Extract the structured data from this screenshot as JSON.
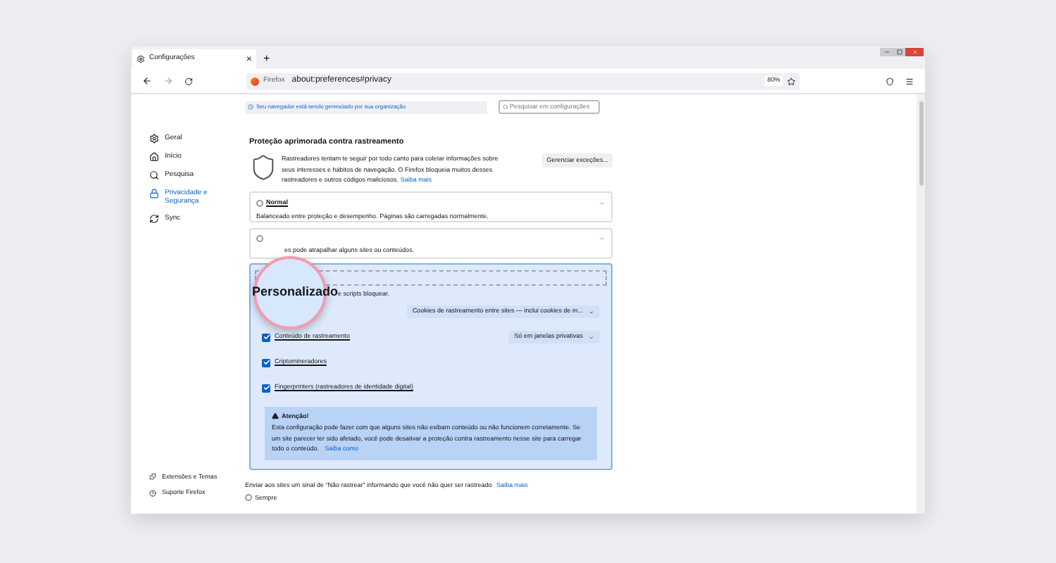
{
  "tab": {
    "title": "Configurações",
    "close": "×",
    "new_tab": "+"
  },
  "nav": {
    "site_label": "Firefox",
    "url": "about:preferences#privacy",
    "zoom": "80%"
  },
  "notice": "Seu navegador está sendo gerenciado por sua organização",
  "search": {
    "placeholder": "Pesquisar em configurações"
  },
  "sidebar": {
    "items": [
      {
        "label": "Geral",
        "selected": false
      },
      {
        "label": "Início",
        "selected": false
      },
      {
        "label": "Pesquisa",
        "selected": false
      },
      {
        "label": "Privacidade e Segurança",
        "selected": true
      },
      {
        "label": "Sync",
        "selected": false
      }
    ],
    "footer": [
      {
        "label": "Extensões e Temas"
      },
      {
        "label": "Suporte Firefox"
      }
    ]
  },
  "section": {
    "title": "Proteção aprimorada contra rastreamento",
    "text": "Rastreadores tentam te seguir por todo canto para coletar informações sobre seus interesses e hábitos de navegação. O Firefox bloqueia muitos desses rastreadores e outros códigos maliciosos.",
    "link": "Saiba mais",
    "button": "Gerenciar exceções..."
  },
  "levels": [
    {
      "label": "Normal",
      "description": "Balanceado entre proteção e desempenho. Páginas são carregadas normalmente.",
      "selected": false
    },
    {
      "description": "es pode atrapalhar alguns sites ou conteúdos.",
      "selected": false
    }
  ],
  "custom": {
    "selected": true,
    "magnified_label": "Personalizado",
    "note": "e scripts bloquear.",
    "rows": [
      {
        "select": "Cookies de rastreamento entre sites — inclui cookies de m..."
      },
      {
        "label": "Conteúdo de rastreamento",
        "checked": true,
        "select": "Só em janelas privativas"
      },
      {
        "label": "Criptomineradores",
        "checked": true
      },
      {
        "label": "Fingerprinters (rastreadores de identidade digital)",
        "checked": true
      }
    ],
    "warning": {
      "title": "Atenção!",
      "text": "Esta configuração pode fazer com que alguns sites não exibam conteúdo ou não funcionem corretamente. Se um site parecer ter sido afetado, você pode desativar a proteção contra rastreamento nesse site para carregar todo o conteúdo.",
      "link": "Saiba como"
    }
  },
  "dnt": {
    "text": "Enviar aos sites um sinal de “Não rastrear” informando que você não quer ser rastreado",
    "link": "Saiba mais",
    "options": [
      {
        "label": "Sempre",
        "selected": false
      }
    ]
  }
}
